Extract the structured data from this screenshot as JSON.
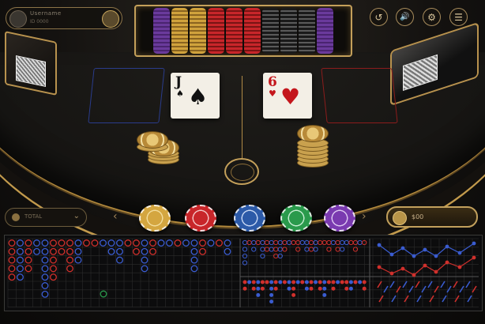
{
  "player": {
    "name": "Username",
    "id": "ID 0000"
  },
  "top_controls": [
    {
      "name": "history-button",
      "icon": "history-icon",
      "glyph": "↺"
    },
    {
      "name": "sound-button",
      "icon": "speaker-icon",
      "glyph": "🔊"
    },
    {
      "name": "settings-button",
      "icon": "gear-icon",
      "glyph": "⚙"
    },
    {
      "name": "menu-button",
      "icon": "menu-icon",
      "glyph": "☰"
    }
  ],
  "cards": {
    "left": {
      "rank": "J",
      "suit": "♠",
      "color": "#111111"
    },
    "right": {
      "rank": "6",
      "suit": "♥",
      "color": "#c4161c"
    }
  },
  "table_selector": {
    "label": "TOTAL"
  },
  "chips": [
    {
      "color": "#d4a640",
      "rim": "#f2dc9a"
    },
    {
      "color": "#c8262a",
      "rim": "#f3c4c4"
    },
    {
      "color": "#2c5aa8",
      "rim": "#c6d6f2"
    },
    {
      "color": "#2a9a4c",
      "rim": "#c4ecd0"
    },
    {
      "color": "#7a3ab0",
      "rim": "#dcc6f0"
    }
  ],
  "balance": {
    "value": "$00"
  },
  "colors": {
    "gold": "#c4a05a",
    "bet_blue": "#2a3c8c",
    "bet_red": "#8c1c1c",
    "road_red": "#d0302c",
    "road_blue": "#3a5cd0"
  }
}
